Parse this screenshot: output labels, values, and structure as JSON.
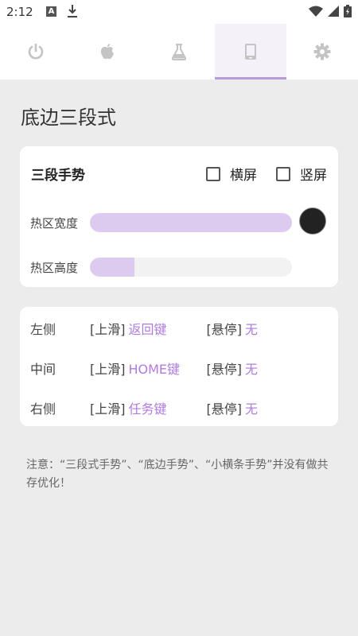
{
  "status": {
    "time": "2:12"
  },
  "tabs": [
    {
      "icon": "power-icon"
    },
    {
      "icon": "apple-icon"
    },
    {
      "icon": "flask-icon"
    },
    {
      "icon": "phone-icon"
    },
    {
      "icon": "gear-icon"
    }
  ],
  "active_tab": 3,
  "page": {
    "title": "底边三段式"
  },
  "gesture_card": {
    "title": "三段手势",
    "landscape_label": "横屏",
    "portrait_label": "竖屏",
    "landscape_checked": false,
    "portrait_checked": false,
    "width_label": "热区宽度",
    "height_label": "热区高度",
    "width_fraction": 1.0,
    "height_fraction": 0.22,
    "color": "#222222"
  },
  "actions": [
    {
      "side": "左侧",
      "up": "[上滑]",
      "up_action": "返回键",
      "hold": "[悬停]",
      "hold_action": "无"
    },
    {
      "side": "中间",
      "up": "[上滑]",
      "up_action": "HOME键",
      "hold": "[悬停]",
      "hold_action": "无"
    },
    {
      "side": "右侧",
      "up": "[上滑]",
      "up_action": "任务键",
      "hold": "[悬停]",
      "hold_action": "无"
    }
  ],
  "note": "注意：“三段式手势”、“底边手势”、“小横条手势”并没有做共存优化！",
  "colors": {
    "accent": "#b07ce0",
    "fill": "#dccbef",
    "tab_indicator": "#b89ad8"
  }
}
